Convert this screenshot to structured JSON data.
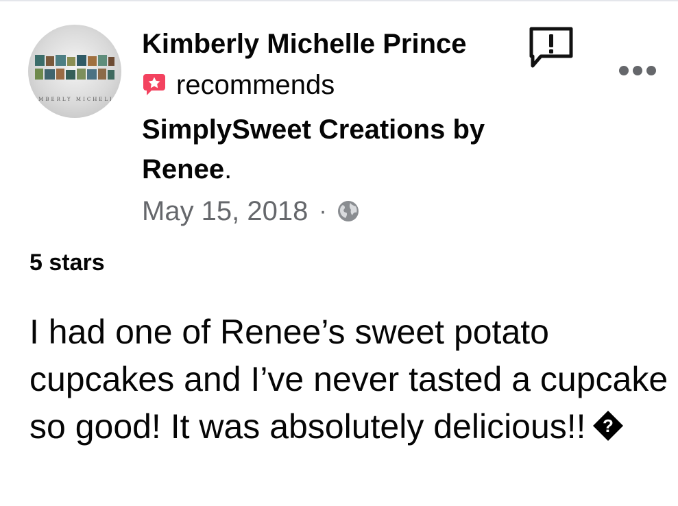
{
  "post": {
    "author_name": "Kimberly Michelle Prince",
    "avatar_caption": "KIMBERLY MICHELLE",
    "recommends_label": "recommends",
    "page_name": "SimplySweet Creations by Renee",
    "page_name_suffix": ".",
    "date": "May 15, 2018",
    "separator": "·",
    "privacy_icon": "globe-icon",
    "rating_text": "5 stars",
    "review_text": "I had one of Renee’s sweet potato cupcakes and I’ve never tasted a cupcake so good! It was absolutely delicious!!",
    "review_trailing_glyph": "?"
  },
  "icons": {
    "report": "report-flag-icon",
    "more": "more-options-icon",
    "recommend": "recommendation-star-icon"
  },
  "colors": {
    "recommend_badge": "#f3425f",
    "secondary_text": "#65676b",
    "primary_text": "#050505"
  }
}
